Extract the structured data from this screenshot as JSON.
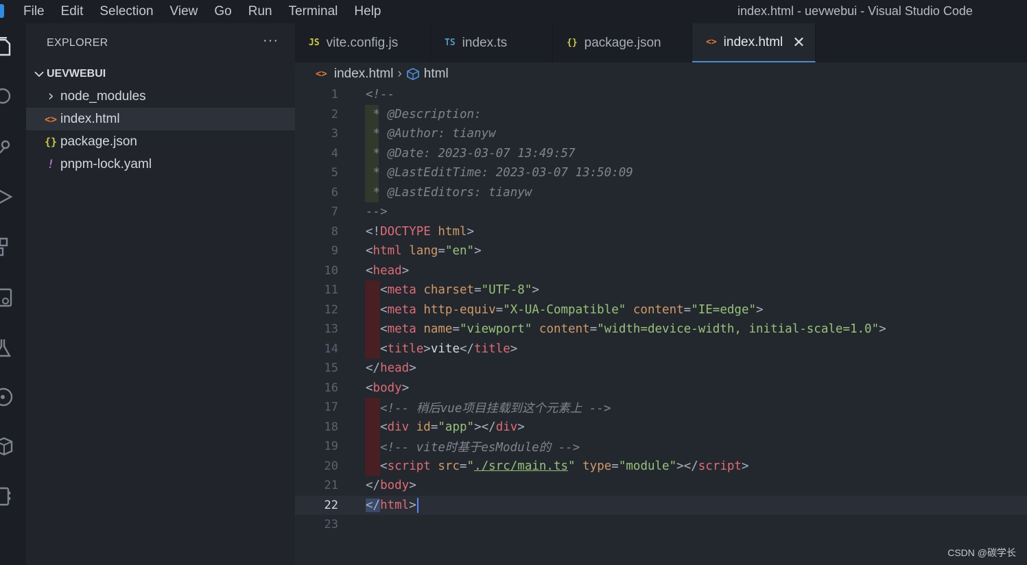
{
  "window": {
    "title": "index.html - uevwebui - Visual Studio Code"
  },
  "menu": [
    "File",
    "Edit",
    "Selection",
    "View",
    "Go",
    "Run",
    "Terminal",
    "Help"
  ],
  "activity_icons": [
    "explorer-icon",
    "search-icon",
    "source-control-icon",
    "run-debug-icon",
    "extensions-icon",
    "remote-explorer-icon",
    "testing-icon",
    "git-graph-icon",
    "packages-icon",
    "notebook-icon"
  ],
  "sidebar": {
    "title": "EXPLORER",
    "more": "···",
    "section": "UEVWEBUI",
    "items": [
      {
        "label": "node_modules",
        "icon": "›",
        "icon_name": "chevron-right-icon",
        "color": "#c5c8cf"
      },
      {
        "label": "index.html",
        "icon": "<>",
        "icon_name": "html-file-icon",
        "color": "#e37933"
      },
      {
        "label": "package.json",
        "icon": "{}",
        "icon_name": "json-file-icon",
        "color": "#cbcb41"
      },
      {
        "label": "pnpm-lock.yaml",
        "icon": "!",
        "icon_name": "yaml-file-icon",
        "color": "#a074c4"
      }
    ]
  },
  "tabs": [
    {
      "label": "vite.config.js",
      "icon": "JS",
      "color": "#cbcb41"
    },
    {
      "label": "index.ts",
      "icon": "TS",
      "color": "#519aba"
    },
    {
      "label": "package.json",
      "icon": "{}",
      "color": "#cbcb41"
    },
    {
      "label": "index.html",
      "icon": "<>",
      "color": "#e37933",
      "close": "✕"
    }
  ],
  "breadcrumb": {
    "file": "index.html",
    "separator": "›",
    "symbol": "html"
  },
  "code": {
    "current_line": 22,
    "lines": [
      [
        [
          "c-comment",
          "<!--"
        ]
      ],
      [
        [
          "c-comment",
          " * @Description:"
        ]
      ],
      [
        [
          "c-comment",
          " * @Author: tianyw"
        ]
      ],
      [
        [
          "c-comment",
          " * @Date: 2023-03-07 13:49:57"
        ]
      ],
      [
        [
          "c-comment",
          " * @LastEditTime: 2023-03-07 13:50:09"
        ]
      ],
      [
        [
          "c-comment",
          " * @LastEditors: tianyw"
        ]
      ],
      [
        [
          "c-comment",
          "-->"
        ]
      ],
      [
        [
          "c-punct",
          "<!"
        ],
        [
          "c-tag",
          "DOCTYPE"
        ],
        [
          "c-punct",
          " "
        ],
        [
          "c-attr",
          "html"
        ],
        [
          "c-punct",
          ">"
        ]
      ],
      [
        [
          "c-punct",
          "<"
        ],
        [
          "c-tag",
          "html"
        ],
        [
          "c-punct",
          " "
        ],
        [
          "c-attr",
          "lang"
        ],
        [
          "c-punct",
          "="
        ],
        [
          "c-str",
          "\"en\""
        ],
        [
          "c-punct",
          ">"
        ]
      ],
      [
        [
          "c-punct",
          "<"
        ],
        [
          "c-tag",
          "head"
        ],
        [
          "c-punct",
          ">"
        ]
      ],
      [
        [
          "c-punct",
          "  <"
        ],
        [
          "c-tag",
          "meta"
        ],
        [
          "c-punct",
          " "
        ],
        [
          "c-attr",
          "charset"
        ],
        [
          "c-punct",
          "="
        ],
        [
          "c-str",
          "\"UTF-8\""
        ],
        [
          "c-punct",
          ">"
        ]
      ],
      [
        [
          "c-punct",
          "  <"
        ],
        [
          "c-tag",
          "meta"
        ],
        [
          "c-punct",
          " "
        ],
        [
          "c-attr",
          "http-equiv"
        ],
        [
          "c-punct",
          "="
        ],
        [
          "c-str",
          "\"X-UA-Compatible\""
        ],
        [
          "c-punct",
          " "
        ],
        [
          "c-attr",
          "content"
        ],
        [
          "c-punct",
          "="
        ],
        [
          "c-str",
          "\"IE=edge\""
        ],
        [
          "c-punct",
          ">"
        ]
      ],
      [
        [
          "c-punct",
          "  <"
        ],
        [
          "c-tag",
          "meta"
        ],
        [
          "c-punct",
          " "
        ],
        [
          "c-attr",
          "name"
        ],
        [
          "c-punct",
          "="
        ],
        [
          "c-str",
          "\"viewport\""
        ],
        [
          "c-punct",
          " "
        ],
        [
          "c-attr",
          "content"
        ],
        [
          "c-punct",
          "="
        ],
        [
          "c-str",
          "\"width=device-width, initial-scale=1.0\""
        ],
        [
          "c-punct",
          ">"
        ]
      ],
      [
        [
          "c-punct",
          "  <"
        ],
        [
          "c-tag",
          "title"
        ],
        [
          "c-punct",
          ">"
        ],
        [
          "c-text",
          "vite"
        ],
        [
          "c-punct",
          "</"
        ],
        [
          "c-tag",
          "title"
        ],
        [
          "c-punct",
          ">"
        ]
      ],
      [
        [
          "c-punct",
          "</"
        ],
        [
          "c-tag",
          "head"
        ],
        [
          "c-punct",
          ">"
        ]
      ],
      [
        [
          "c-punct",
          "<"
        ],
        [
          "c-tag",
          "body"
        ],
        [
          "c-punct",
          ">"
        ]
      ],
      [
        [
          "c-comment",
          "  <!-- 稍后vue项目挂载到这个元素上 -->"
        ]
      ],
      [
        [
          "c-punct",
          "  <"
        ],
        [
          "c-tag",
          "div"
        ],
        [
          "c-punct",
          " "
        ],
        [
          "c-attr",
          "id"
        ],
        [
          "c-punct",
          "="
        ],
        [
          "c-str",
          "\"app\""
        ],
        [
          "c-punct",
          "></"
        ],
        [
          "c-tag",
          "div"
        ],
        [
          "c-punct",
          ">"
        ]
      ],
      [
        [
          "c-comment",
          "  <!-- vite时基于esModule的 -->"
        ]
      ],
      [
        [
          "c-punct",
          "  <"
        ],
        [
          "c-tag",
          "script"
        ],
        [
          "c-punct",
          " "
        ],
        [
          "c-attr",
          "src"
        ],
        [
          "c-punct",
          "="
        ],
        [
          "c-str",
          "\""
        ],
        [
          "c-str c-link",
          "./src/main.ts"
        ],
        [
          "c-str",
          "\""
        ],
        [
          "c-punct",
          " "
        ],
        [
          "c-attr",
          "type"
        ],
        [
          "c-punct",
          "="
        ],
        [
          "c-str",
          "\"module\""
        ],
        [
          "c-punct",
          "></"
        ],
        [
          "c-tag",
          "script"
        ],
        [
          "c-punct",
          ">"
        ]
      ],
      [
        [
          "c-punct",
          "</"
        ],
        [
          "c-tag",
          "body"
        ],
        [
          "c-punct",
          ">"
        ]
      ],
      [
        [
          "c-punct",
          "</"
        ],
        [
          "c-tag",
          "html"
        ],
        [
          "c-punct",
          ">"
        ]
      ],
      []
    ]
  },
  "watermark": "CSDN @碳学长"
}
